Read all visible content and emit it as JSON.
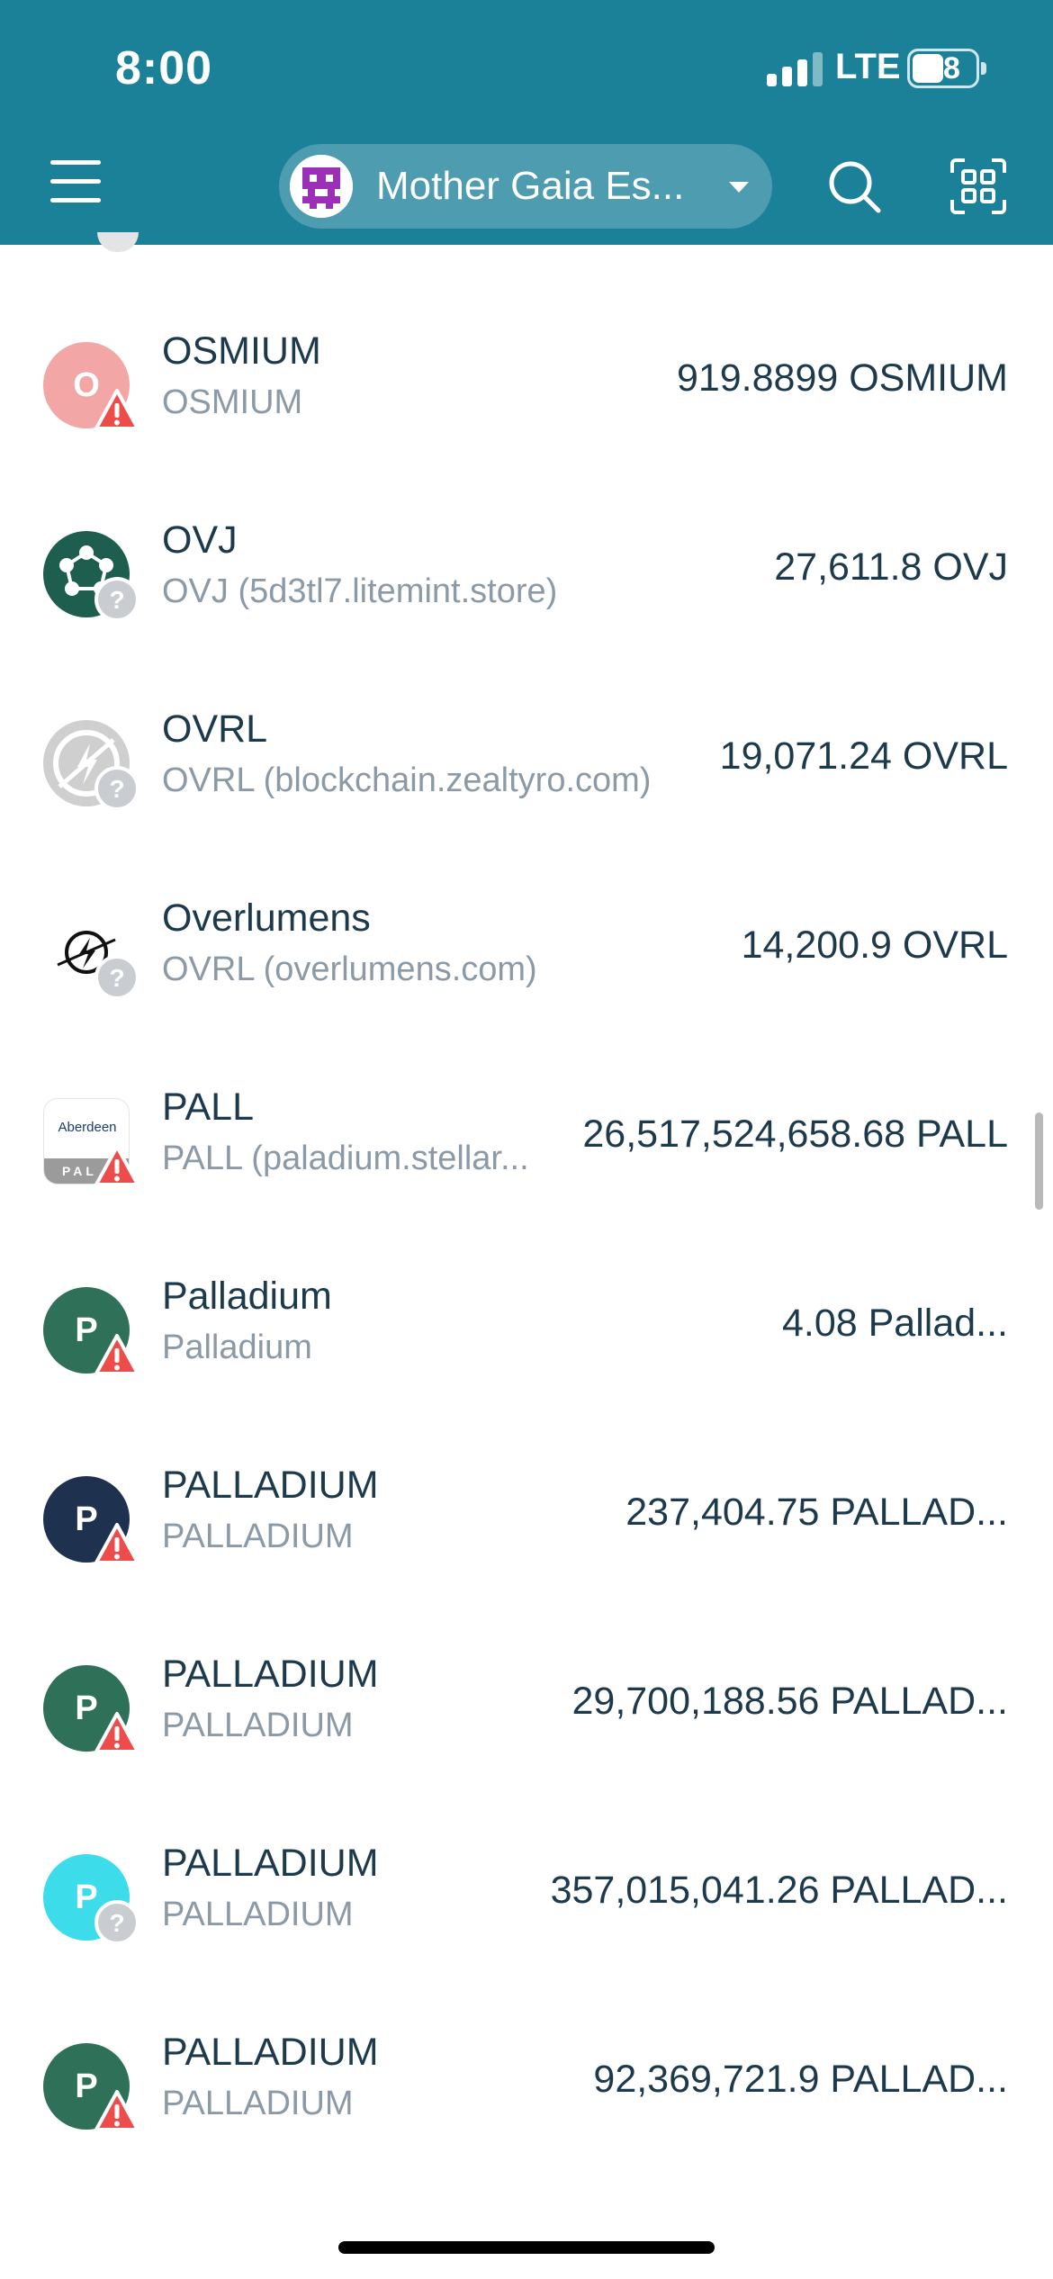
{
  "status_bar": {
    "time": "8:00",
    "network": "LTE",
    "battery": "48"
  },
  "header": {
    "account_name": "Mother Gaia Es...",
    "menu_icon": "hamburger-icon",
    "search_icon": "search-icon",
    "scan_icon": "qr-scan-icon"
  },
  "colors": {
    "header_bg": "#1b8199",
    "text_primary": "#1d3a4d",
    "text_secondary": "#8b9aa6",
    "warning_badge": "#ee4b4b",
    "unknown_badge": "#c9ccd0"
  },
  "assets": [
    {
      "name": "OSMIUM",
      "sub": "OSMIUM",
      "amount": "919.8899 OSMIUM",
      "icon_letter": "O",
      "icon_color": "#f2a6a6",
      "badge": "warning"
    },
    {
      "name": "OVJ",
      "sub": "OVJ (5d3tl7.litemint.store)",
      "amount": "27,611.8 OVJ",
      "icon_letter": "",
      "icon_color": "#1e5e4e",
      "badge": "unknown"
    },
    {
      "name": "OVRL",
      "sub": "OVRL (blockchain.zealtyro.com)",
      "amount": "19,071.24 OVRL",
      "icon_letter": "",
      "icon_color": "#cfcfcf",
      "badge": "unknown"
    },
    {
      "name": "Overlumens",
      "sub": "OVRL (overlumens.com)",
      "amount": "14,200.9 OVRL",
      "icon_letter": "",
      "icon_color": "#ffffff",
      "badge": "unknown"
    },
    {
      "name": "PALL",
      "sub": "PALL (paladium.stellar...",
      "amount": "26,517,524,658.68 PALL",
      "icon_letter": "Aberdeen",
      "icon_color": "#ffffff",
      "badge": "warning"
    },
    {
      "name": "Palladium",
      "sub": "Palladium",
      "amount": "4.08 Pallad...",
      "icon_letter": "P",
      "icon_color": "#2e7058",
      "badge": "warning"
    },
    {
      "name": "PALLADIUM",
      "sub": "PALLADIUM",
      "amount": "237,404.75 PALLAD...",
      "icon_letter": "P",
      "icon_color": "#1e3250",
      "badge": "warning"
    },
    {
      "name": "PALLADIUM",
      "sub": "PALLADIUM",
      "amount": "29,700,188.56 PALLAD...",
      "icon_letter": "P",
      "icon_color": "#2e7058",
      "badge": "warning"
    },
    {
      "name": "PALLADIUM",
      "sub": "PALLADIUM",
      "amount": "357,015,041.26 PALLAD...",
      "icon_letter": "P",
      "icon_color": "#3ddceb",
      "badge": "unknown"
    },
    {
      "name": "PALLADIUM",
      "sub": "PALLADIUM",
      "amount": "92,369,721.9 PALLAD...",
      "icon_letter": "P",
      "icon_color": "#2e7058",
      "badge": "warning"
    }
  ]
}
